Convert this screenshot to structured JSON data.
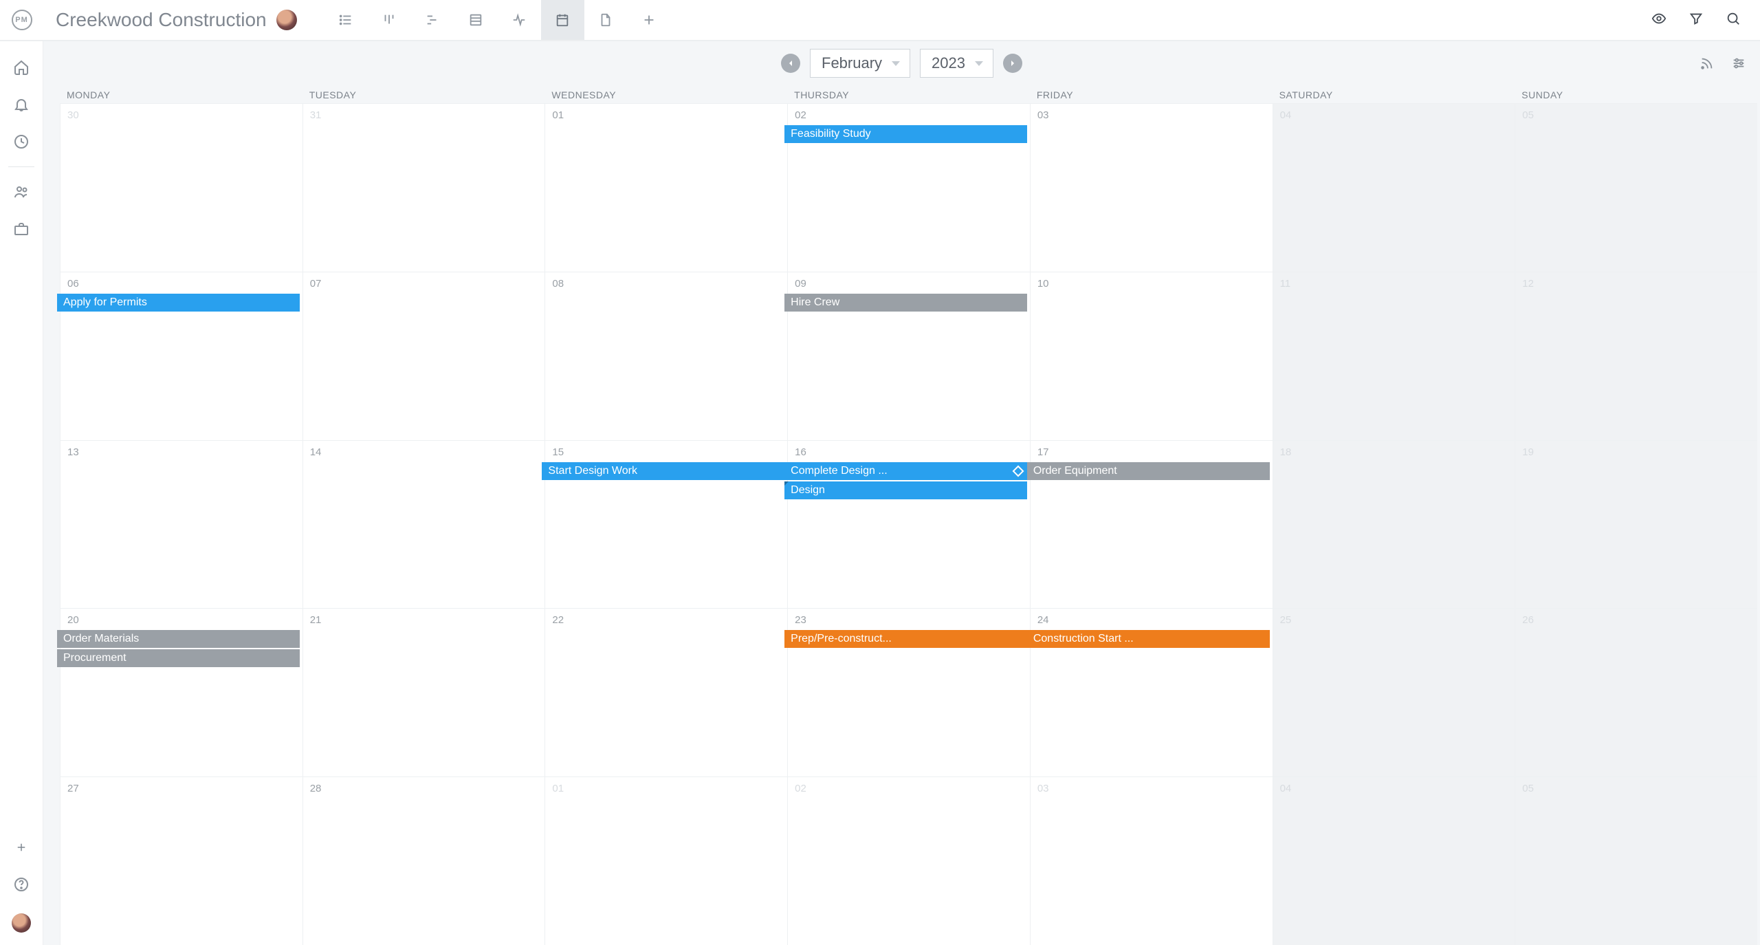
{
  "header": {
    "logo_text": "PM",
    "project_title": "Creekwood Construction"
  },
  "view_tabs": [
    {
      "id": "list",
      "name": "list-view"
    },
    {
      "id": "board",
      "name": "board-view"
    },
    {
      "id": "gantt",
      "name": "gantt-view"
    },
    {
      "id": "sheet",
      "name": "sheet-view"
    },
    {
      "id": "activity",
      "name": "activity-view"
    },
    {
      "id": "calendar",
      "name": "calendar-view",
      "active": true
    },
    {
      "id": "files",
      "name": "files-view"
    },
    {
      "id": "add",
      "name": "add-view"
    }
  ],
  "calendar": {
    "month": "February",
    "year": "2023",
    "weekdays": [
      "MONDAY",
      "TUESDAY",
      "WEDNESDAY",
      "THURSDAY",
      "FRIDAY",
      "SATURDAY",
      "SUNDAY"
    ],
    "rows": 5,
    "cols": 7,
    "days": [
      {
        "num": "30",
        "workday": true,
        "dim": true
      },
      {
        "num": "31",
        "workday": true,
        "dim": true
      },
      {
        "num": "01",
        "workday": true
      },
      {
        "num": "02",
        "workday": true
      },
      {
        "num": "03",
        "workday": true
      },
      {
        "num": "04",
        "workday": false,
        "dim": true
      },
      {
        "num": "05",
        "workday": false,
        "dim": true
      },
      {
        "num": "06",
        "workday": true
      },
      {
        "num": "07",
        "workday": true
      },
      {
        "num": "08",
        "workday": true
      },
      {
        "num": "09",
        "workday": true
      },
      {
        "num": "10",
        "workday": true
      },
      {
        "num": "11",
        "workday": false,
        "dim": true
      },
      {
        "num": "12",
        "workday": false,
        "dim": true
      },
      {
        "num": "13",
        "workday": true
      },
      {
        "num": "14",
        "workday": true
      },
      {
        "num": "15",
        "workday": true
      },
      {
        "num": "16",
        "workday": true
      },
      {
        "num": "17",
        "workday": true
      },
      {
        "num": "18",
        "workday": false,
        "dim": true
      },
      {
        "num": "19",
        "workday": false,
        "dim": true
      },
      {
        "num": "20",
        "workday": true
      },
      {
        "num": "21",
        "workday": true
      },
      {
        "num": "22",
        "workday": true
      },
      {
        "num": "23",
        "workday": true
      },
      {
        "num": "24",
        "workday": true
      },
      {
        "num": "25",
        "workday": false,
        "dim": true
      },
      {
        "num": "26",
        "workday": false,
        "dim": true
      },
      {
        "num": "27",
        "workday": true
      },
      {
        "num": "28",
        "workday": true
      },
      {
        "num": "01",
        "workday": true,
        "dim": true
      },
      {
        "num": "02",
        "workday": true,
        "dim": true
      },
      {
        "num": "03",
        "workday": true,
        "dim": true
      },
      {
        "num": "04",
        "workday": false,
        "dim": true
      },
      {
        "num": "05",
        "workday": false,
        "dim": true
      }
    ],
    "events": [
      {
        "label": "Feasibility Study",
        "color": "blue",
        "row": 0,
        "colStart": 3,
        "span": 1,
        "slot": 0
      },
      {
        "label": "Apply for Permits",
        "color": "blue",
        "row": 1,
        "colStart": 0,
        "span": 1,
        "slot": 0
      },
      {
        "label": "Hire Crew",
        "color": "grey",
        "row": 1,
        "colStart": 3,
        "span": 1,
        "slot": 0
      },
      {
        "label": "Start Design Work",
        "color": "blue",
        "row": 2,
        "colStart": 2,
        "span": 1,
        "slot": 0
      },
      {
        "label": "Complete Design ...",
        "color": "blue",
        "row": 2,
        "colStart": 3,
        "span": 1,
        "slot": 0,
        "milestone": true
      },
      {
        "label": "Order Equipment",
        "color": "grey",
        "row": 2,
        "colStart": 4,
        "span": 1,
        "slot": 0
      },
      {
        "label": "Design",
        "color": "blue",
        "row": 2,
        "colStart": 3,
        "span": 1,
        "slot": 1,
        "continued": true
      },
      {
        "label": "Order Materials",
        "color": "grey",
        "row": 3,
        "colStart": 0,
        "span": 1,
        "slot": 0
      },
      {
        "label": "Procurement",
        "color": "grey",
        "row": 3,
        "colStart": 0,
        "span": 1,
        "slot": 1
      },
      {
        "label": "Prep/Pre-construct...",
        "color": "orange",
        "row": 3,
        "colStart": 3,
        "span": 1,
        "slot": 0
      },
      {
        "label": "Construction Start ...",
        "color": "orange",
        "row": 3,
        "colStart": 4,
        "span": 1,
        "slot": 0
      }
    ]
  }
}
